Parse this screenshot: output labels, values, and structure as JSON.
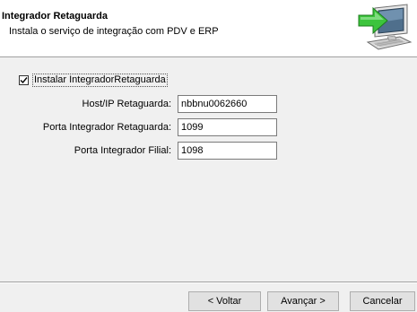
{
  "header": {
    "title": "Integrador Retaguarda",
    "subtitle": "Instala o serviço de integração com PDV e ERP",
    "icon": "computer-install-arrow-icon"
  },
  "options": {
    "install_label": "Instalar IntegradorRetaguarda",
    "install_checked": true
  },
  "fields": {
    "host": {
      "label": "Host/IP Retaguarda:",
      "value": "nbbnu0062660"
    },
    "port_retaguarda": {
      "label": "Porta Integrador Retaguarda:",
      "value": "1099"
    },
    "port_filial": {
      "label": "Porta Integrador Filial:",
      "value": "1098"
    }
  },
  "buttons": {
    "back": "< Voltar",
    "next": "Avançar >",
    "cancel": "Cancelar"
  }
}
